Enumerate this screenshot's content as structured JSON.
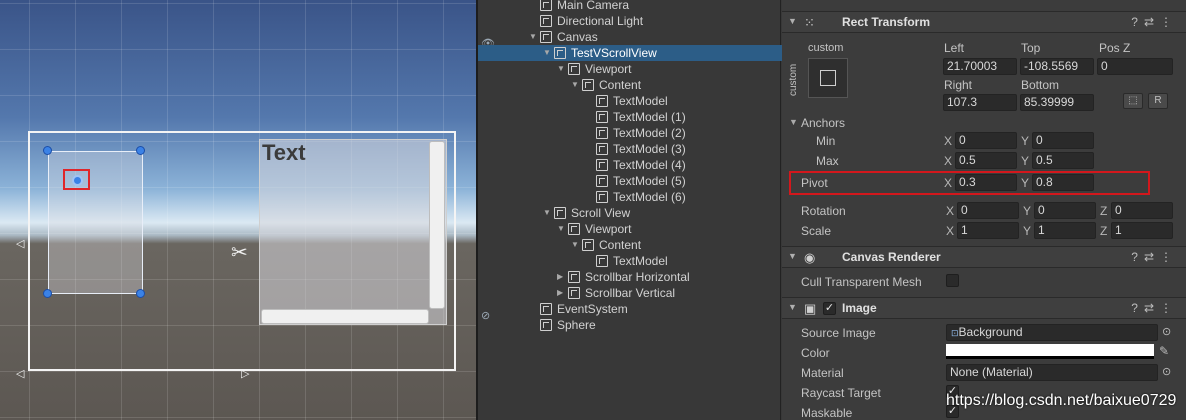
{
  "hierarchy": {
    "items": [
      {
        "label": "Main Camera",
        "indent": 0,
        "expand": ""
      },
      {
        "label": "Directional Light",
        "indent": 0,
        "expand": ""
      },
      {
        "label": "Canvas",
        "indent": 0,
        "expand": "▼"
      },
      {
        "label": "TestVScrollView",
        "indent": 1,
        "expand": "▼",
        "selected": true
      },
      {
        "label": "Viewport",
        "indent": 2,
        "expand": "▼"
      },
      {
        "label": "Content",
        "indent": 3,
        "expand": "▼"
      },
      {
        "label": "TextModel",
        "indent": 4,
        "expand": ""
      },
      {
        "label": "TextModel (1)",
        "indent": 4,
        "expand": ""
      },
      {
        "label": "TextModel (2)",
        "indent": 4,
        "expand": ""
      },
      {
        "label": "TextModel (3)",
        "indent": 4,
        "expand": ""
      },
      {
        "label": "TextModel (4)",
        "indent": 4,
        "expand": ""
      },
      {
        "label": "TextModel (5)",
        "indent": 4,
        "expand": ""
      },
      {
        "label": "TextModel (6)",
        "indent": 4,
        "expand": ""
      },
      {
        "label": "Scroll View",
        "indent": 1,
        "expand": "▼"
      },
      {
        "label": "Viewport",
        "indent": 2,
        "expand": "▼"
      },
      {
        "label": "Content",
        "indent": 3,
        "expand": "▼"
      },
      {
        "label": "TextModel",
        "indent": 4,
        "expand": ""
      },
      {
        "label": "Scrollbar Horizontal",
        "indent": 2,
        "expand": "▶"
      },
      {
        "label": "Scrollbar Vertical",
        "indent": 2,
        "expand": "▶"
      },
      {
        "label": "EventSystem",
        "indent": 0,
        "expand": ""
      },
      {
        "label": "Sphere",
        "indent": 0,
        "expand": ""
      }
    ]
  },
  "scene": {
    "text_label": "Text"
  },
  "inspector": {
    "rect_transform": {
      "title": "Rect Transform",
      "preset_top": "custom",
      "preset_side": "custom",
      "left_label": "Left",
      "left_value": "21.70003",
      "top_label": "Top",
      "top_value": "-108.5569",
      "posz_label": "Pos Z",
      "posz_value": "0",
      "right_label": "Right",
      "right_value": "107.3",
      "bottom_label": "Bottom",
      "bottom_value": "85.39999",
      "r_button": "R",
      "anchors_label": "Anchors",
      "min_label": "Min",
      "min_x": "0",
      "min_y": "0",
      "max_label": "Max",
      "max_x": "0.5",
      "max_y": "0.5",
      "pivot_label": "Pivot",
      "pivot_x": "0.3",
      "pivot_y": "0.8",
      "rotation_label": "Rotation",
      "rot_x": "0",
      "rot_y": "0",
      "rot_z": "0",
      "scale_label": "Scale",
      "scale_x": "1",
      "scale_y": "1",
      "scale_z": "1",
      "x": "X",
      "y": "Y",
      "z": "Z"
    },
    "canvas_renderer": {
      "title": "Canvas Renderer",
      "cull_label": "Cull Transparent Mesh"
    },
    "image": {
      "title": "Image",
      "source_label": "Source Image",
      "source_value": "Background",
      "color_label": "Color",
      "material_label": "Material",
      "material_value": "None (Material)",
      "raycast_label": "Raycast Target",
      "maskable_label": "Maskable"
    }
  },
  "watermark": "https://blog.csdn.net/baixue0729",
  "colors": {
    "selection": "#2c5d87",
    "highlight_red": "#d3171c",
    "handle_blue": "#3b82e6"
  }
}
